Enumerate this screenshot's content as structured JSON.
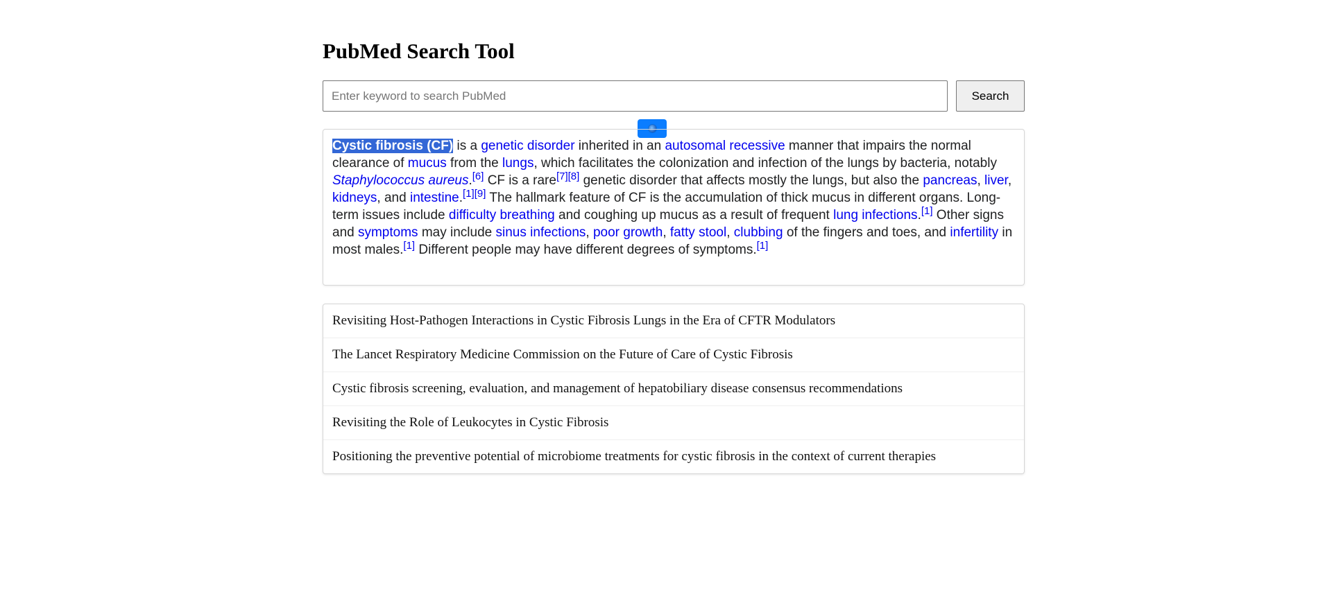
{
  "page": {
    "title": "PubMed Search Tool"
  },
  "search": {
    "placeholder": "Enter keyword to search PubMed",
    "value": "",
    "button_label": "Search"
  },
  "floating_badge": {
    "icon": "globe-icon",
    "color": "#0b7dff"
  },
  "summary": {
    "highlight": "Cystic fibrosis (CF)",
    "t1": " is a ",
    "l_genetic_disorder": "genetic disorder",
    "t2": " inherited in an ",
    "l_autosomal_recessive": "autosomal recessive",
    "t3": " manner that impairs the normal clearance of ",
    "l_mucus": "mucus",
    "t4": " from the ",
    "l_lungs": "lungs",
    "t5": ", which facilitates the colonization and infection of the lungs by bacteria, notably ",
    "l_staph": "Staphylococcus aureus",
    "t6": ".",
    "ref_6": "[6]",
    "t7": " CF is a rare",
    "ref_7": "[7]",
    "ref_8": "[8]",
    "t8": " genetic disorder that affects mostly the lungs, but also the ",
    "l_pancreas": "pancreas",
    "sep1": ", ",
    "l_liver": "liver",
    "sep2": ", ",
    "l_kidneys": "kidneys",
    "t9": ", and ",
    "l_intestine": "intestine",
    "t10": ".",
    "ref_1a": "[1]",
    "ref_9": "[9]",
    "t11": " The hallmark feature of CF is the accumulation of thick mucus in different organs. Long-term issues include ",
    "l_difficulty_breathing": "difficulty breathing",
    "t12": " and coughing up mucus as a result of frequent ",
    "l_lung_infections": "lung infections",
    "t13": ".",
    "ref_1b": "[1]",
    "t14": " Other signs and ",
    "l_symptoms": "symptoms",
    "t15": " may include ",
    "l_sinus_infections": "sinus infections",
    "sep3": ", ",
    "l_poor_growth": "poor growth",
    "sep4": ", ",
    "l_fatty_stool": "fatty stool",
    "sep5": ", ",
    "l_clubbing": "clubbing",
    "t16": " of the fingers and toes, and ",
    "l_infertility": "infertility",
    "t17": " in most males.",
    "ref_1c": "[1]",
    "t18": " Different people may have different degrees of symptoms.",
    "ref_1d": "[1]"
  },
  "results": [
    "Revisiting Host-Pathogen Interactions in Cystic Fibrosis Lungs in the Era of CFTR Modulators",
    "The Lancet Respiratory Medicine Commission on the Future of Care of Cystic Fibrosis",
    "Cystic fibrosis screening, evaluation, and management of hepatobiliary disease consensus recommendations",
    "Revisiting the Role of Leukocytes in Cystic Fibrosis",
    "Positioning the preventive potential of microbiome treatments for cystic fibrosis in the context of current therapies"
  ],
  "colors": {
    "link": "#0000ee",
    "highlight_bg": "#3367d6",
    "badge": "#0b7dff"
  }
}
